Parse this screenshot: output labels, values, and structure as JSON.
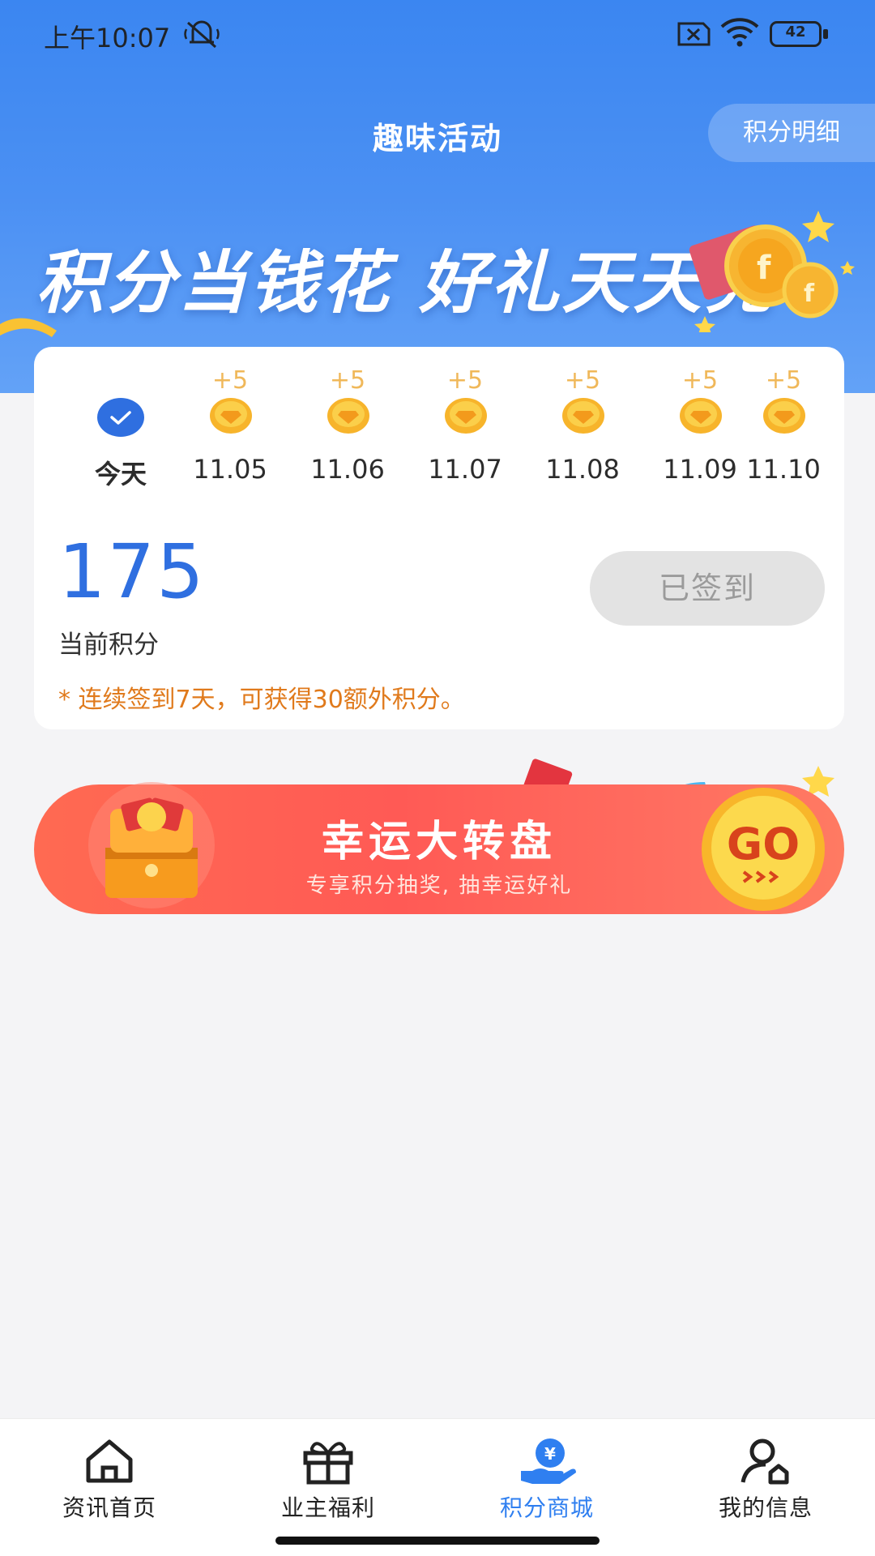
{
  "status_bar": {
    "time": "上午10:07",
    "battery": "42"
  },
  "header": {
    "title": "趣味活动",
    "detail_button": "积分明细",
    "slogan": "积分当钱花  好礼天天兑"
  },
  "signin": {
    "days": [
      {
        "date": "今天",
        "bonus": "",
        "checked": true
      },
      {
        "date": "11.05",
        "bonus": "+5",
        "checked": false
      },
      {
        "date": "11.06",
        "bonus": "+5",
        "checked": false
      },
      {
        "date": "11.07",
        "bonus": "+5",
        "checked": false
      },
      {
        "date": "11.08",
        "bonus": "+5",
        "checked": false
      },
      {
        "date": "11.09",
        "bonus": "+5",
        "checked": false
      },
      {
        "date": "11.10",
        "bonus": "+5",
        "checked": false
      }
    ],
    "points": "175",
    "points_label": "当前积分",
    "button": "已签到",
    "hint": "* 连续签到7天，可获得30额外积分。"
  },
  "lucky_wheel": {
    "title": "幸运大转盘",
    "subtitle": "专享积分抽奖, 抽幸运好礼",
    "go": "GO"
  },
  "bottom_nav": {
    "items": [
      {
        "label": "资讯首页",
        "icon": "home-icon",
        "active": false
      },
      {
        "label": "业主福利",
        "icon": "gift-icon",
        "active": false
      },
      {
        "label": "积分商城",
        "icon": "points-mall-icon",
        "active": true
      },
      {
        "label": "我的信息",
        "icon": "profile-icon",
        "active": false
      }
    ]
  },
  "colors": {
    "primary_blue": "#2f7ff0",
    "header_gradient_top": "#3b86f1",
    "hint_orange": "#e07a1c",
    "banner_red": "#ff5a55"
  }
}
